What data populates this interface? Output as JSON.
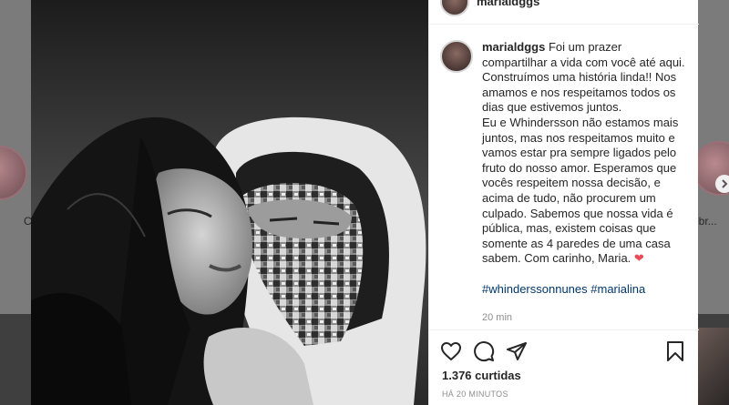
{
  "background": {
    "left_label": "C",
    "right_label": "obr..."
  },
  "post": {
    "username": "marialdggs",
    "caption_lines": [
      "Foi um prazer",
      "compartilhar a vida com você até aqui.",
      "Construímos uma história linda!! Nos",
      "amamos e nos respeitamos todos os",
      "dias que estivemos juntos.",
      "Eu e Whindersson não estamos mais",
      "juntos, mas nos respeitamos muito e",
      "vamos estar pra sempre ligados pelo",
      "fruto do nosso amor. Esperamos que",
      "vocês respeitem nossa decisão, e",
      "acima de tudo, não procurem um",
      "culpado. Sabemos que nossa vida é",
      "pública, mas, existem coisas que",
      "somente as 4 paredes de uma casa",
      "sabem. Com carinho, Maria."
    ],
    "heart_emoji": "❤",
    "hashtag_1": "#whinderssonnunes",
    "hashtag_2": "#marialina",
    "comment_time": "20 min",
    "likes": "1.376 curtidas",
    "posted_ago": "HÁ 20 MINUTOS"
  },
  "icons": {
    "like": "heart-outline-icon",
    "comment": "speech-bubble-icon",
    "share": "paper-plane-icon",
    "save": "bookmark-icon"
  },
  "colors": {
    "text": "#262626",
    "muted": "#8e8e8e",
    "link": "#00376b",
    "heart": "#ed4956"
  }
}
